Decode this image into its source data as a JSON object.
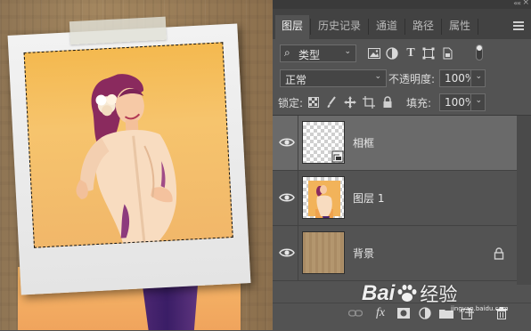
{
  "panel": {
    "tabs": [
      {
        "label": "图层",
        "active": true
      },
      {
        "label": "历史记录",
        "active": false
      },
      {
        "label": "通道",
        "active": false
      },
      {
        "label": "路径",
        "active": false
      },
      {
        "label": "属性",
        "active": false
      }
    ],
    "collapse_glyph": "««",
    "close_glyph": "×",
    "filter": {
      "search_glyph": "⌕",
      "label": "类型"
    },
    "filter_icons": [
      "image-filter-icon",
      "adjustment-filter-icon",
      "text-filter-icon",
      "shape-filter-icon",
      "smart-object-filter-icon"
    ],
    "filter_text_glyph": "T",
    "blend_mode": "正常",
    "opacity_label": "不透明度:",
    "opacity_value": "100%",
    "lock_label": "锁定:",
    "fill_label": "填充:",
    "fill_value": "100%",
    "dropdown_glyph": "⌄",
    "layers": [
      {
        "name": "相框",
        "selected": true,
        "thumb": "transparent-frame"
      },
      {
        "name": "图层 1",
        "selected": false,
        "thumb": "photo"
      },
      {
        "name": "背景",
        "selected": false,
        "thumb": "wood",
        "locked": true
      }
    ],
    "bottom_tools": {
      "fx_label": "fx",
      "icons": [
        "link-layers-icon",
        "fx-icon",
        "mask-icon",
        "adjustment-layer-icon",
        "group-icon",
        "new-layer-icon",
        "delete-icon"
      ]
    }
  },
  "watermark": {
    "text_left": "Bai",
    "text_right": "经验",
    "url": "jingyan.baidu.com"
  },
  "colors": {
    "panel_bg": "#535353",
    "tab_bar": "#424242",
    "selected_layer": "#6a6a6a",
    "photo_warm": "#f4b94f",
    "frame_white": "#f2f2f2"
  }
}
